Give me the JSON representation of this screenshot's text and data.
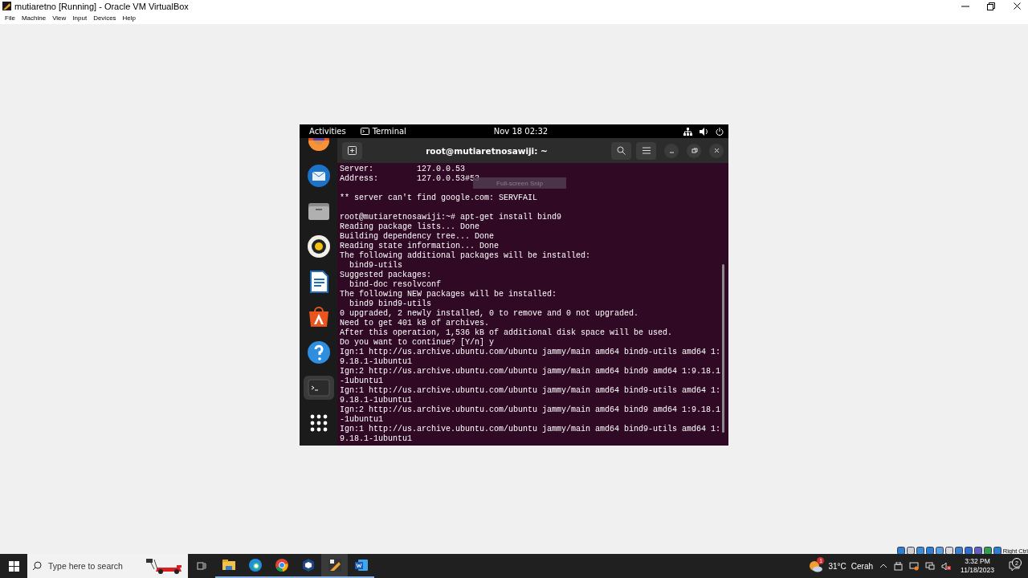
{
  "window": {
    "title": "mutiaretno [Running] - Oracle VM VirtualBox"
  },
  "menu": [
    "File",
    "Machine",
    "View",
    "Input",
    "Devices",
    "Help"
  ],
  "vm": {
    "top_bar": {
      "activities": "Activities",
      "app": "Terminal",
      "clock": "Nov 18  02:32"
    },
    "dock": [
      {
        "kind": "browser",
        "selected": false
      },
      {
        "kind": "mail",
        "selected": false
      },
      {
        "kind": "files",
        "selected": false
      },
      {
        "kind": "music",
        "selected": false
      },
      {
        "kind": "writer",
        "selected": false
      },
      {
        "kind": "store",
        "selected": false
      },
      {
        "kind": "help",
        "selected": false
      },
      {
        "kind": "terminal",
        "selected": true
      },
      {
        "kind": "grid",
        "selected": false
      }
    ],
    "terminal": {
      "title": "root@mutiaretnosawiji: ~",
      "blocks": [
        [
          "Server:         127.0.0.53",
          "Address:        127.0.0.53#53"
        ],
        [
          "** server can't find google.com: SERVFAIL"
        ],
        [
          "root@mutiaretnosawiji:~# apt-get install bind9",
          "Reading package lists... Done",
          "Building dependency tree... Done",
          "Reading state information... Done",
          "The following additional packages will be installed:",
          "  bind9-utils",
          "Suggested packages:",
          "  bind-doc resolvconf",
          "The following NEW packages will be installed:",
          "  bind9 bind9-utils",
          "0 upgraded, 2 newly installed, 0 to remove and 0 not upgraded.",
          "Need to get 401 kB of archives.",
          "After this operation, 1,536 kB of additional disk space will be used.",
          "Do you want to continue? [Y/n] y",
          "Ign:1 http://us.archive.ubuntu.com/ubuntu jammy/main amd64 bind9-utils amd64 1:",
          "9.18.1-1ubuntu1",
          "Ign:2 http://us.archive.ubuntu.com/ubuntu jammy/main amd64 bind9 amd64 1:9.18.1",
          "-1ubuntu1",
          "Ign:1 http://us.archive.ubuntu.com/ubuntu jammy/main amd64 bind9-utils amd64 1:",
          "9.18.1-1ubuntu1",
          "Ign:2 http://us.archive.ubuntu.com/ubuntu jammy/main amd64 bind9 amd64 1:9.18.1",
          "-1ubuntu1",
          "Ign:1 http://us.archive.ubuntu.com/ubuntu jammy/main amd64 bind9-utils amd64 1:",
          "9.18.1-1ubuntu1"
        ]
      ]
    },
    "tooltip": "Full-screen Snip"
  },
  "vbox_status": {
    "label": "Right Ctrl"
  },
  "taskbar": {
    "search": {
      "placeholder": "Type here to search"
    },
    "apps": [
      {
        "kind": "explorer",
        "selected": false
      },
      {
        "kind": "edge",
        "selected": false
      },
      {
        "kind": "chrome",
        "selected": false
      },
      {
        "kind": "virtualbox",
        "selected": false
      },
      {
        "kind": "vm",
        "selected": true
      },
      {
        "kind": "word",
        "selected": false
      }
    ],
    "weather": {
      "badge": "1",
      "temperature": "31°C",
      "condition": "Cerah"
    },
    "time": "3:32 PM",
    "date": "11/18/2023",
    "notifications": "2"
  }
}
